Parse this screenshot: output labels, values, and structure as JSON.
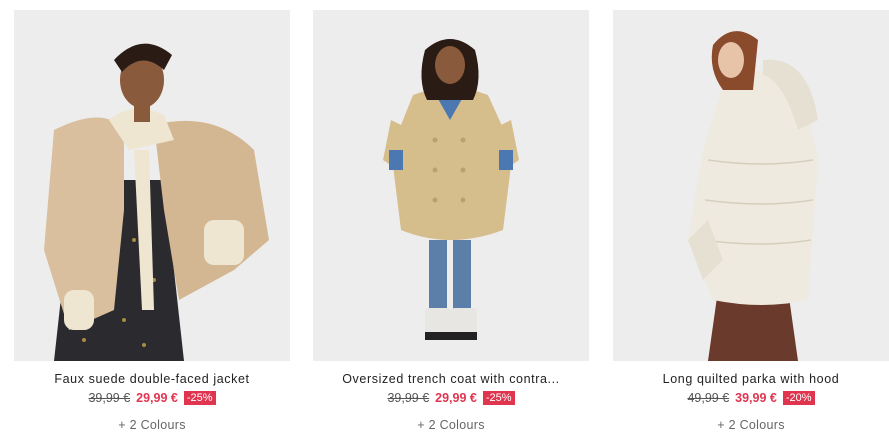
{
  "products": [
    {
      "name": "Faux suede double-faced jacket",
      "old_price": "39,99 €",
      "new_price": "29,99 €",
      "discount": "-25%",
      "colours": "+ 2 Colours"
    },
    {
      "name": "Oversized trench coat with contra...",
      "old_price": "39,99 €",
      "new_price": "29,99 €",
      "discount": "-25%",
      "colours": "+ 2 Colours"
    },
    {
      "name": "Long quilted parka with hood",
      "old_price": "49,99 €",
      "new_price": "39,99 €",
      "discount": "-20%",
      "colours": "+ 2 Colours"
    }
  ],
  "colors": {
    "sale": "#e0354f",
    "photo_bg": "#ececec"
  }
}
